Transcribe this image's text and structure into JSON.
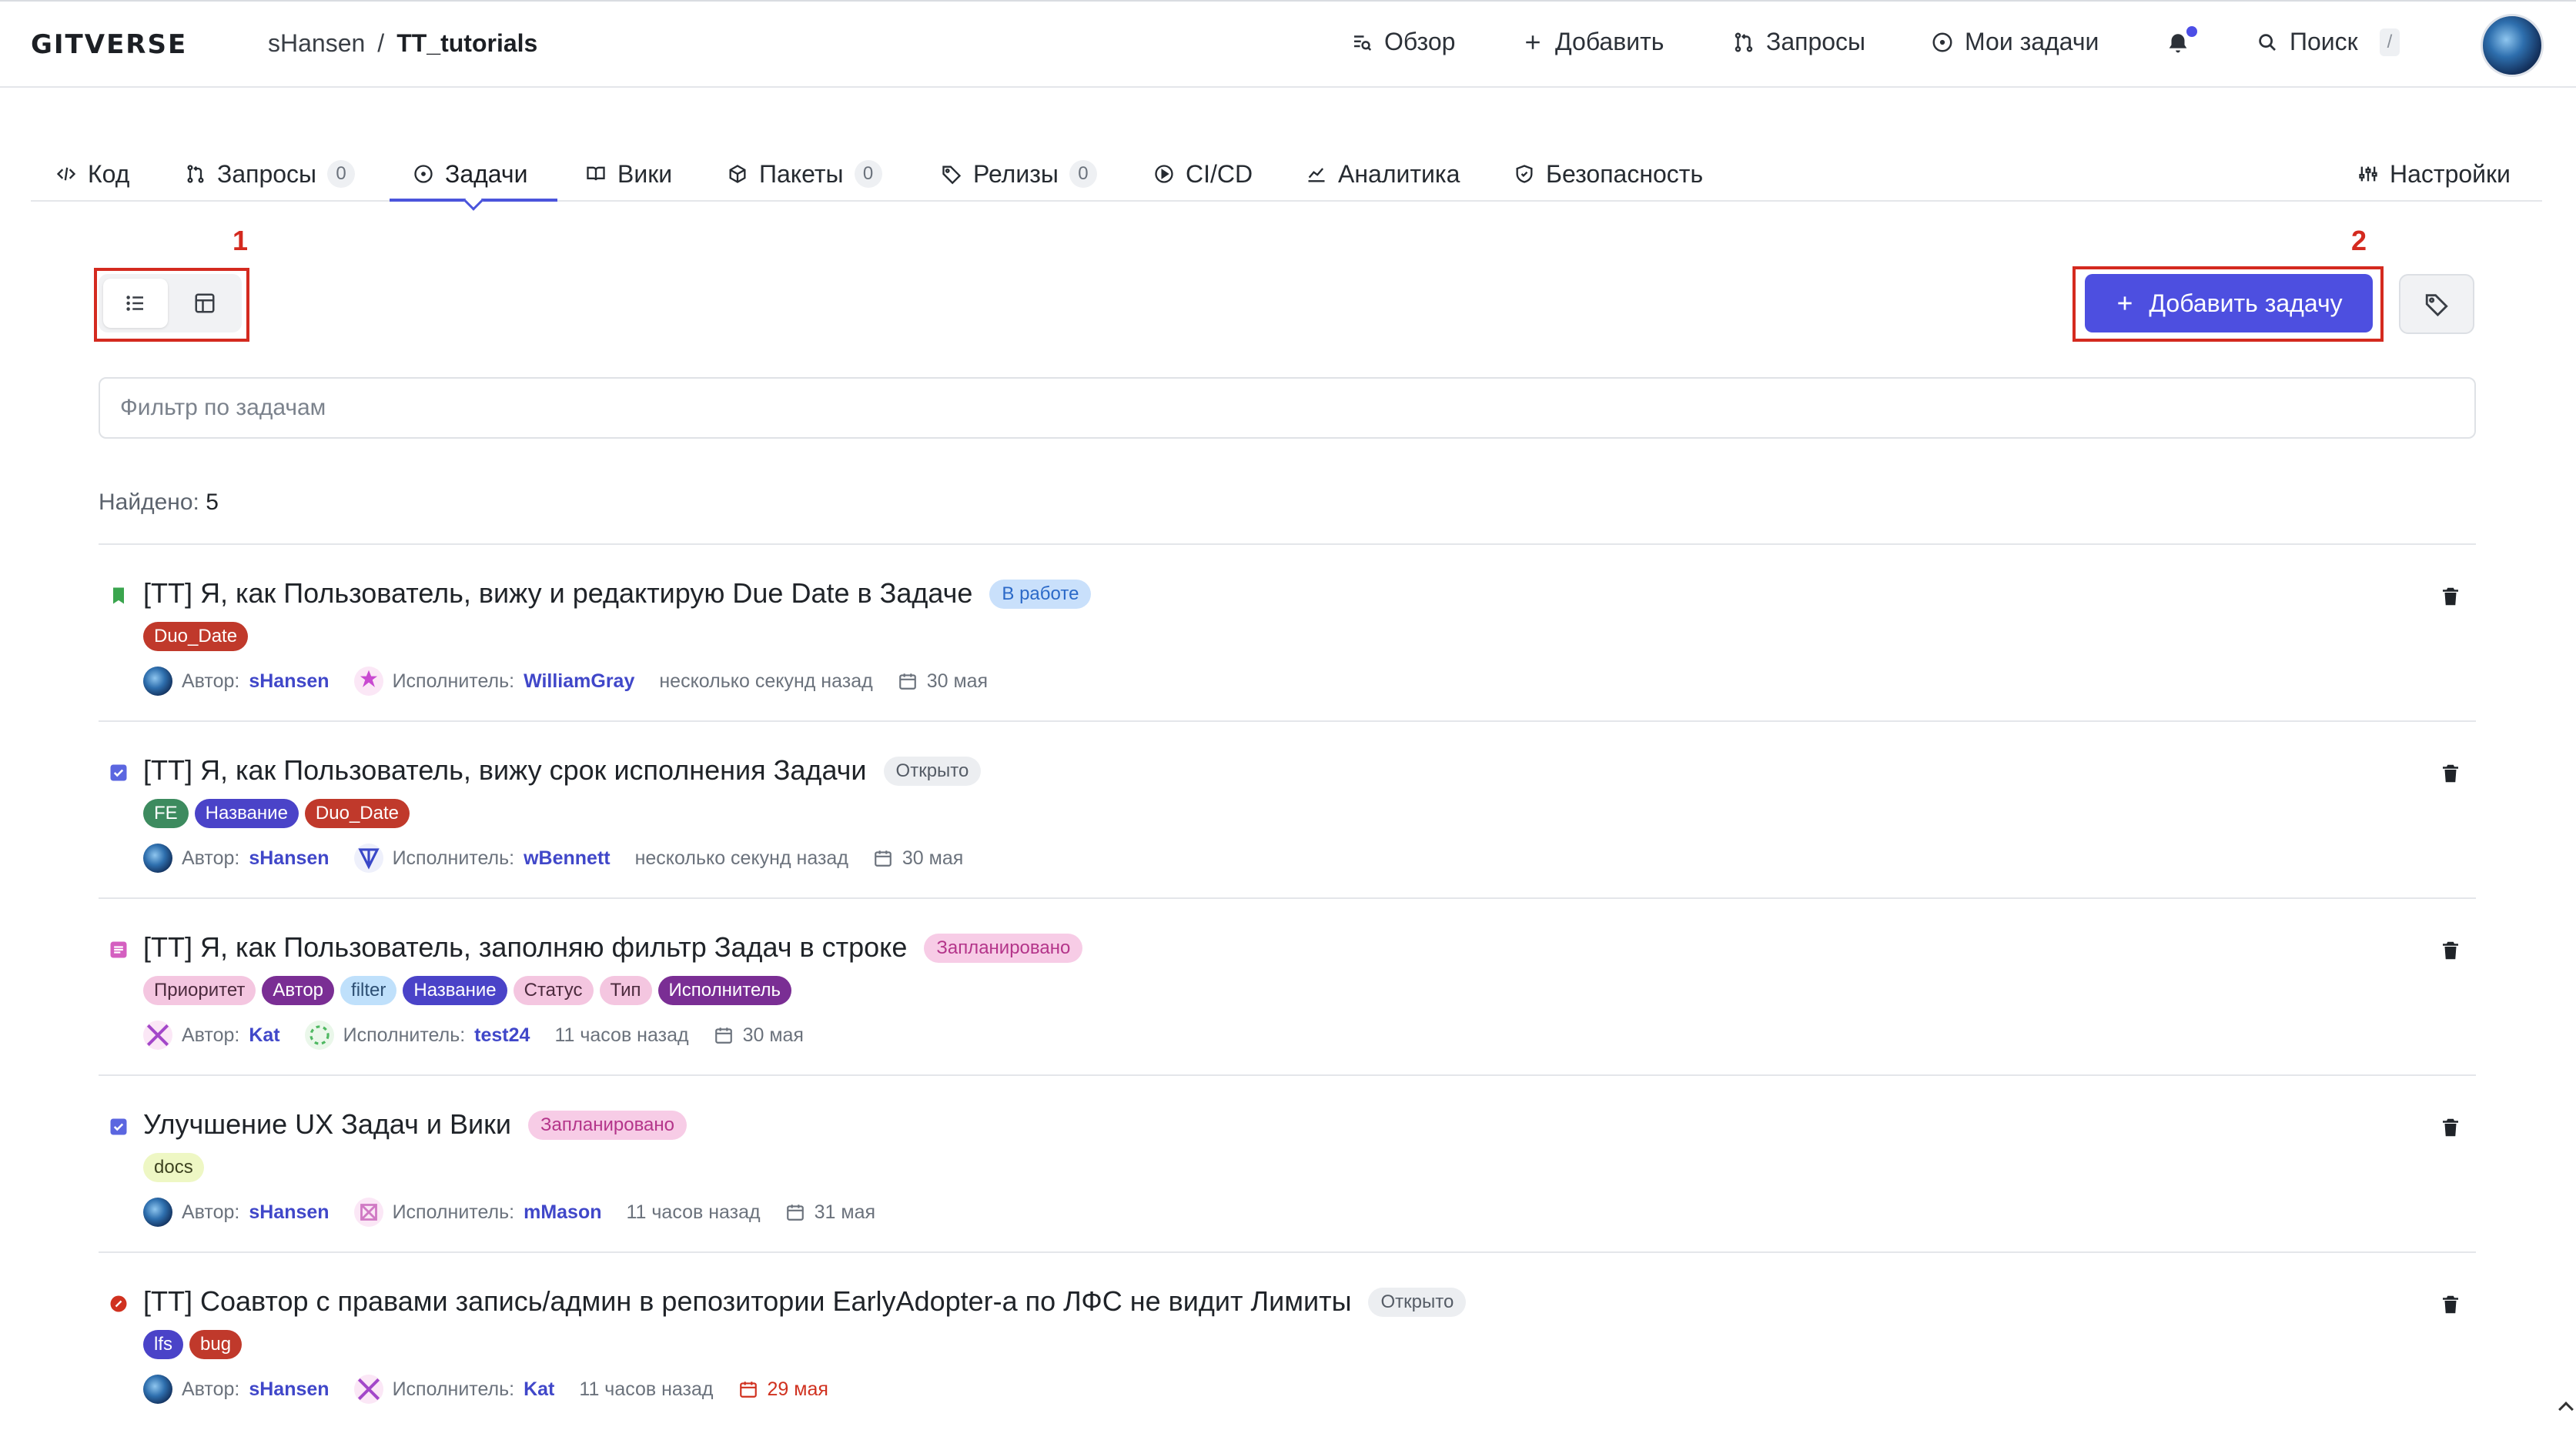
{
  "header": {
    "logo": "GITVERSE",
    "breadcrumb": {
      "owner": "sHansen",
      "repo": "TT_tutorials",
      "separator": "/"
    },
    "nav": {
      "overview": "Обзор",
      "add": "Добавить",
      "requests": "Запросы",
      "my_tasks": "Мои задачи",
      "search": "Поиск",
      "search_shortcut": "/"
    }
  },
  "tabs": [
    {
      "label": "Код",
      "icon": "code-icon"
    },
    {
      "label": "Запросы",
      "count": "0",
      "icon": "pull-request-icon"
    },
    {
      "label": "Задачи",
      "icon": "issue-icon",
      "active": true
    },
    {
      "label": "Вики",
      "icon": "book-icon"
    },
    {
      "label": "Пакеты",
      "count": "0",
      "icon": "package-icon"
    },
    {
      "label": "Релизы",
      "count": "0",
      "icon": "tag-icon"
    },
    {
      "label": "CI/CD",
      "icon": "play-icon"
    },
    {
      "label": "Аналитика",
      "icon": "chart-icon"
    },
    {
      "label": "Безопасность",
      "icon": "shield-icon"
    },
    {
      "label": "Настройки",
      "icon": "sliders-icon"
    }
  ],
  "annotations": {
    "one": "1",
    "two": "2",
    "color": "#d42a1f"
  },
  "toolbar": {
    "add_task_label": "Добавить задачу",
    "filter_placeholder": "Фильтр по задачам",
    "found_label": "Найдено:",
    "found_count": "5"
  },
  "meta_labels": {
    "author": "Автор:",
    "assignee": "Исполнитель:"
  },
  "issues": [
    {
      "title": "[TT] Я, как Пользователь, вижу и редактирую Due Date в Задаче",
      "status": "В работе",
      "labels": [
        {
          "text": "Duo_Date",
          "color": "#c0392b"
        }
      ],
      "author": "sHansen",
      "assignee": "WilliamGray",
      "time": "несколько секунд назад",
      "due": "30 мая"
    },
    {
      "title": "[TT] Я, как Пользователь, вижу срок исполнения Задачи",
      "status": "Открыто",
      "labels": [
        {
          "text": "FE",
          "color": "#3d8b5f"
        },
        {
          "text": "Название",
          "color": "#4a43c8"
        },
        {
          "text": "Duo_Date",
          "color": "#c0392b"
        }
      ],
      "author": "sHansen",
      "assignee": "wBennett",
      "time": "несколько секунд назад",
      "due": "30 мая"
    },
    {
      "title": "[TT] Я, как Пользователь, заполняю фильтр Задач в строке",
      "status": "Запланировано",
      "labels": [
        {
          "text": "Приоритет",
          "color": "#f4c6e0"
        },
        {
          "text": "Автор",
          "color": "#7a2e94"
        },
        {
          "text": "filter",
          "color": "#bfe0fb"
        },
        {
          "text": "Название",
          "color": "#4a43c8"
        },
        {
          "text": "Статус",
          "color": "#f4c6e0"
        },
        {
          "text": "Тип",
          "color": "#f4c6e0"
        },
        {
          "text": "Исполнитель",
          "color": "#7a2e94"
        }
      ],
      "author": "Kat",
      "assignee": "test24",
      "time": "11 часов назад",
      "due": "30 мая"
    },
    {
      "title": "Улучшение UX Задач и Вики",
      "status": "Запланировано",
      "labels": [
        {
          "text": "docs",
          "color": "#eef7c4"
        }
      ],
      "author": "sHansen",
      "assignee": "mMason",
      "time": "11 часов назад",
      "due": "31 мая"
    },
    {
      "title": "[TT] Соавтор с правами запись/админ в репозитории EarlyAdopter-а по ЛФС не видит Лимиты",
      "status": "Открыто",
      "labels": [
        {
          "text": "lfs",
          "color": "#4a43c8"
        },
        {
          "text": "bug",
          "color": "#c0392b"
        }
      ],
      "author": "sHansen",
      "assignee": "Kat",
      "time": "11 часов назад",
      "due": "29 мая",
      "due_overdue": true
    }
  ]
}
